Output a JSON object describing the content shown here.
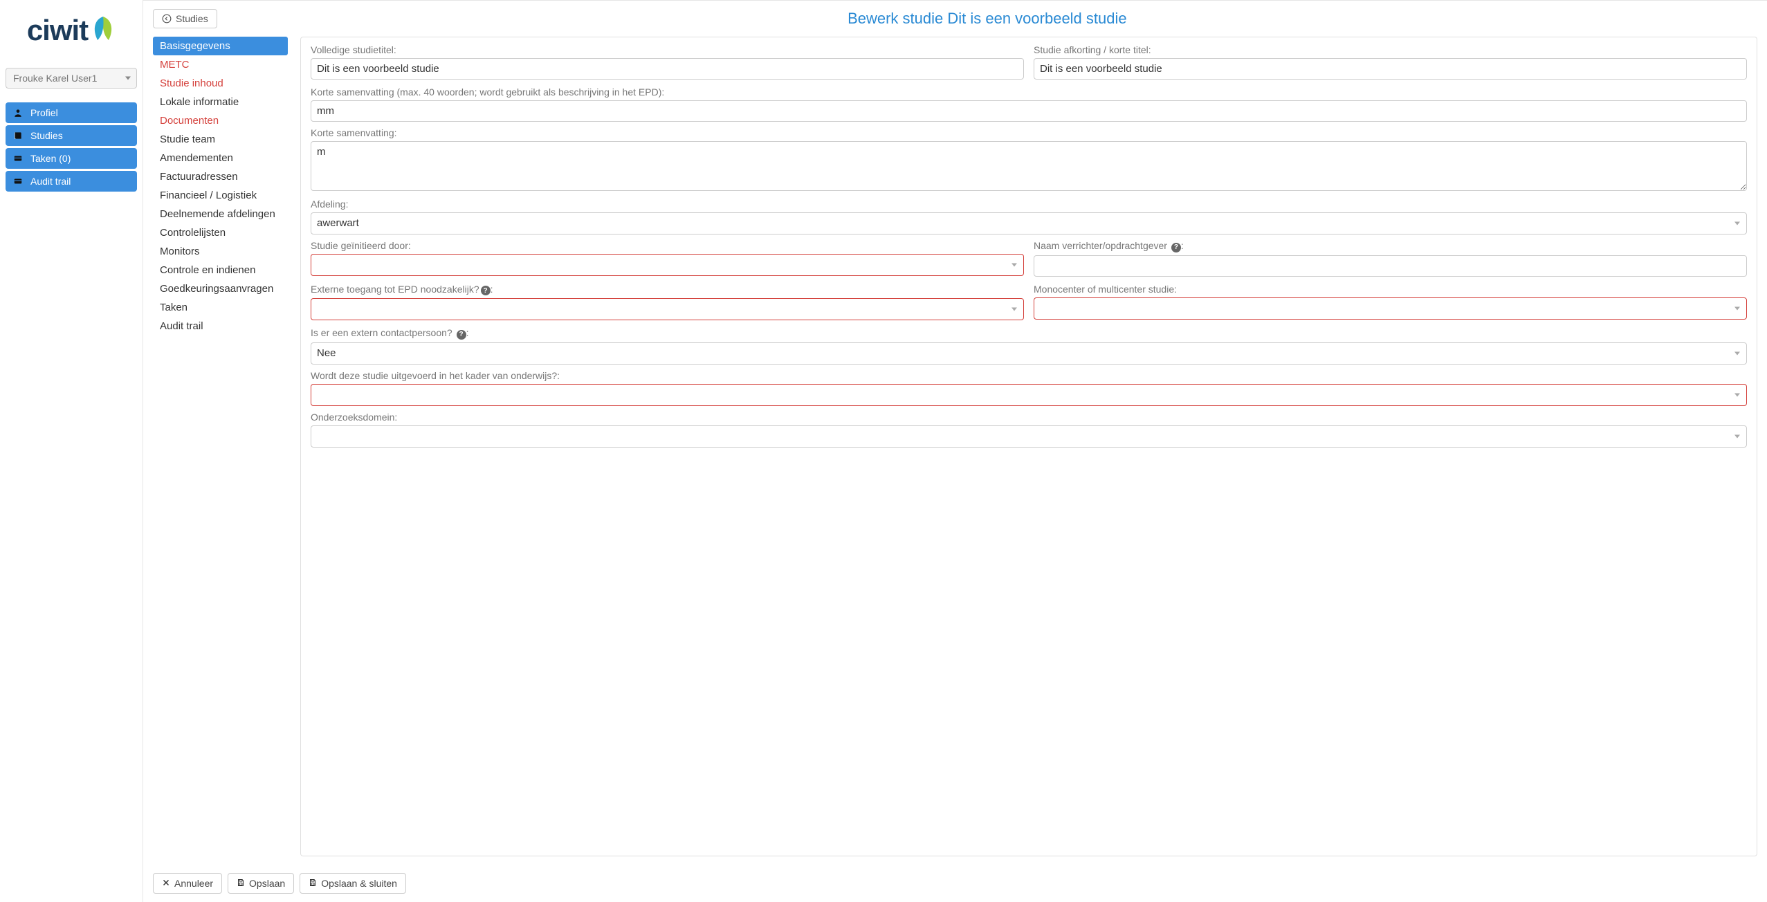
{
  "logo": {
    "text": "ciwit"
  },
  "user": {
    "name": "Frouke Karel User1"
  },
  "nav": [
    {
      "icon": "user",
      "label": "Profiel"
    },
    {
      "icon": "book",
      "label": "Studies"
    },
    {
      "icon": "card",
      "label": "Taken (0)"
    },
    {
      "icon": "card",
      "label": "Audit trail"
    }
  ],
  "backButton": "Studies",
  "pageTitle": "Bewerk studie Dit is een voorbeeld studie",
  "tabs": [
    {
      "label": "Basisgegevens",
      "required": true,
      "active": true
    },
    {
      "label": "METC",
      "required": true
    },
    {
      "label": "Studie inhoud",
      "required": true
    },
    {
      "label": "Lokale informatie"
    },
    {
      "label": "Documenten",
      "required": true
    },
    {
      "label": "Studie team"
    },
    {
      "label": "Amendementen"
    },
    {
      "label": "Factuuradressen"
    },
    {
      "label": "Financieel / Logistiek"
    },
    {
      "label": "Deelnemende afdelingen"
    },
    {
      "label": "Controlelijsten"
    },
    {
      "label": "Monitors"
    },
    {
      "label": "Controle en indienen"
    },
    {
      "label": "Goedkeuringsaanvragen"
    },
    {
      "label": "Taken"
    },
    {
      "label": "Audit trail"
    }
  ],
  "form": {
    "fullTitle": {
      "label": "Volledige studietitel:",
      "value": "Dit is een voorbeeld studie"
    },
    "shortTitle": {
      "label": "Studie afkorting / korte titel:",
      "value": "Dit is een voorbeeld studie"
    },
    "summary40": {
      "label": "Korte samenvatting (max. 40 woorden; wordt gebruikt als beschrijving in het EPD):",
      "value": "mm"
    },
    "summary": {
      "label": "Korte samenvatting:",
      "value": "m"
    },
    "department": {
      "label": "Afdeling:",
      "value": "awerwart"
    },
    "initiatedBy": {
      "label": "Studie geïnitieerd door:",
      "value": ""
    },
    "clientName": {
      "label": "Naam verrichter/opdrachtgever",
      "value": ""
    },
    "externalEpd": {
      "label": "Externe toegang tot EPD noodzakelijk?",
      "value": ""
    },
    "monoMulti": {
      "label": "Monocenter of multicenter studie:",
      "value": ""
    },
    "externalContact": {
      "label": "Is er een extern contactpersoon?",
      "value": "Nee"
    },
    "education": {
      "label": "Wordt deze studie uitgevoerd in het kader van onderwijs?:",
      "value": ""
    },
    "domain": {
      "label": "Onderzoeksdomein:",
      "value": ""
    }
  },
  "footer": {
    "cancel": "Annuleer",
    "save": "Opslaan",
    "saveClose": "Opslaan & sluiten"
  }
}
